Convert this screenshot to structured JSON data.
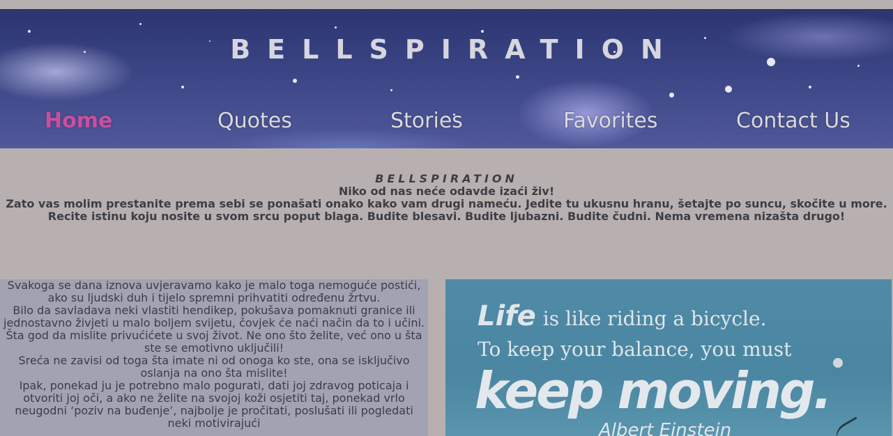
{
  "header": {
    "site_title": "BELLSPIRATION",
    "nav": [
      {
        "label": "Home",
        "active": true
      },
      {
        "label": "Quotes",
        "active": false
      },
      {
        "label": "Stories",
        "active": false
      },
      {
        "label": "Favorites",
        "active": false
      },
      {
        "label": "Contact Us",
        "active": false
      }
    ]
  },
  "intro": {
    "title": "BELLSPIRATION",
    "line1": "Niko od nas neće odavde izaći živ!",
    "line2": "Zato vas molim prestanite prema sebi se ponašati onako kako vam drugi nameću. Jedite tu ukusnu hranu, šetajte po suncu, skočite u more. Recite istinu koju nosite u svom srcu poput blaga. Budite blesavi. Budite ljubazni. Budite čudni. Nema vremena nizašta drugo!"
  },
  "main": {
    "paragraphs": [
      "Svakoga se dana iznova uvjeravamo kako je malo toga nemoguće postići, ako su ljudski duh i tijelo spremni prihvatiti određenu žrtvu.",
      "Bilo da savladava neki vlastiti hendikep, pokušava pomaknuti granice ili jednostavno živjeti u malo boljem svijetu, čovjek će naći način da to i učini.",
      "Šta god da mislite privućićete u svoj život. Ne ono što želite, već ono u šta ste se emotivno uključili!",
      "Sreća ne zavisi od toga šta imate ni od onoga ko ste, ona se isključivo oslanja na ono šta mislite!",
      "Ipak, ponekad ju je potrebno malo pogurati, dati joj zdravog poticaja i otvoriti joj oči, a ako ne želite na svojoj koži osjetiti taj, ponekad vrlo neugodni ‘poziv na buđenje’, najbolje je pročitati, poslušati ili pogledati neki motivirajući"
    ],
    "quote_image": {
      "word_life": "Life",
      "line1_rest": "is like riding a bicycle.",
      "line2": "To keep your balance, you must",
      "line3": "keep moving.",
      "author": "Albert Einstein"
    }
  },
  "colors": {
    "page_bg": "#b8b0b0",
    "nav_active": "#c9509e",
    "nav_text": "#dadada",
    "left_panel_bg": "#a2a2b3",
    "quote_bg": "#4f8aa6"
  }
}
